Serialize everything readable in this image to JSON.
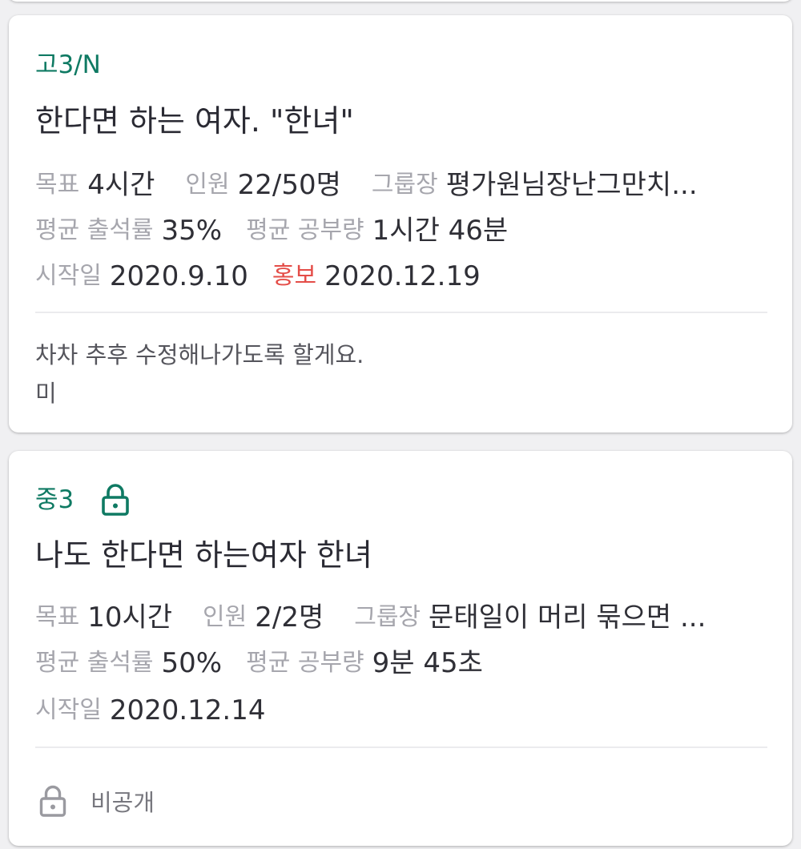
{
  "colors": {
    "accent_green": "#0f7a63",
    "promo_red": "#e44d48",
    "label_gray": "#a6a6ad",
    "text_dark": "#2a2a33"
  },
  "groups": [
    {
      "grade": "고3/N",
      "title": "한다면 하는 여자. \"한녀\"",
      "goal_label": "목표",
      "goal_value": "4시간",
      "members_label": "인원",
      "members_value": "22/50명",
      "leader_label": "그룹장",
      "leader_value": "평가원님장난그만치...",
      "attendance_label": "평균 출석률",
      "attendance_value": "35%",
      "study_label": "평균 공부량",
      "study_value": "1시간 46분",
      "start_label": "시작일",
      "start_value": "2020.9.10",
      "promo_label": "홍보",
      "promo_value": "2020.12.19",
      "description_line1": "차차 추후 수정해나가도록 할게요.",
      "description_line2": "미"
    },
    {
      "grade": "중3",
      "lock_icon": "lock-icon",
      "title": "나도 한다면 하는여자 한녀",
      "goal_label": "목표",
      "goal_value": "10시간",
      "members_label": "인원",
      "members_value": "2/2명",
      "leader_label": "그룹장",
      "leader_value": "문태일이 머리 묶으면 ...",
      "attendance_label": "평균 출석률",
      "attendance_value": "50%",
      "study_label": "평균 공부량",
      "study_value": "9분 45초",
      "start_label": "시작일",
      "start_value": "2020.12.14",
      "private_label": "비공개"
    }
  ]
}
